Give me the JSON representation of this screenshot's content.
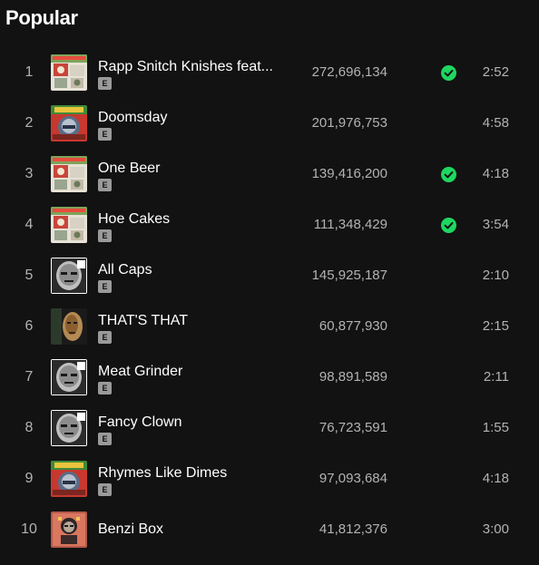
{
  "section": {
    "title": "Popular"
  },
  "colors": {
    "background": "#121212",
    "accent": "#1ed760",
    "muted": "#b3b3b3"
  },
  "tracks": [
    {
      "index": "1",
      "title": "Rapp Snitch Knishes feat...",
      "explicit": "E",
      "plays": "272,696,134",
      "saved": true,
      "duration": "2:52",
      "cover": "mm-food-cover"
    },
    {
      "index": "2",
      "title": "Doomsday",
      "explicit": "E",
      "plays": "201,976,753",
      "saved": false,
      "duration": "4:58",
      "cover": "operation-doomsday-cover"
    },
    {
      "index": "3",
      "title": "One Beer",
      "explicit": "E",
      "plays": "139,416,200",
      "saved": true,
      "duration": "4:18",
      "cover": "mm-food-cover"
    },
    {
      "index": "4",
      "title": "Hoe Cakes",
      "explicit": "E",
      "plays": "111,348,429",
      "saved": true,
      "duration": "3:54",
      "cover": "mm-food-cover"
    },
    {
      "index": "5",
      "title": "All Caps",
      "explicit": "E",
      "plays": "145,925,187",
      "saved": false,
      "duration": "2:10",
      "cover": "madvillainy-cover"
    },
    {
      "index": "6",
      "title": "THAT'S THAT",
      "explicit": "E",
      "plays": "60,877,930",
      "saved": false,
      "duration": "2:15",
      "cover": "born-like-this-cover"
    },
    {
      "index": "7",
      "title": "Meat Grinder",
      "explicit": "E",
      "plays": "98,891,589",
      "saved": false,
      "duration": "2:11",
      "cover": "madvillainy-cover"
    },
    {
      "index": "8",
      "title": "Fancy Clown",
      "explicit": "E",
      "plays": "76,723,591",
      "saved": false,
      "duration": "1:55",
      "cover": "madvillainy-cover"
    },
    {
      "index": "9",
      "title": "Rhymes Like Dimes",
      "explicit": "E",
      "plays": "97,093,684",
      "saved": false,
      "duration": "4:18",
      "cover": "operation-doomsday-cover"
    },
    {
      "index": "10",
      "title": "Benzi Box",
      "explicit": "",
      "plays": "41,812,376",
      "saved": false,
      "duration": "3:00",
      "cover": "danger-doom-cover"
    }
  ]
}
